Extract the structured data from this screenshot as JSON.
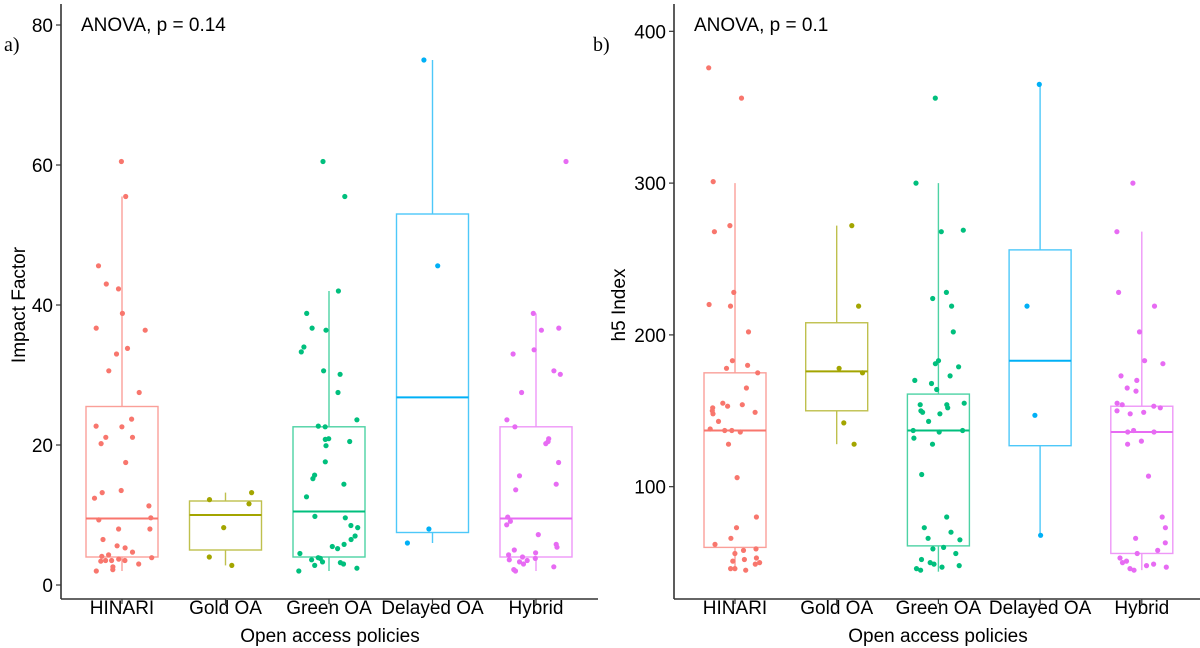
{
  "chart_data": [
    {
      "type": "boxplot",
      "panel_label": "a)",
      "annotation": "ANOVA, p = 0.14",
      "xlabel": "Open access policies",
      "ylabel": "Impact Factor",
      "ylim": [
        -2,
        83
      ],
      "yticks": [
        0,
        20,
        40,
        60,
        80
      ],
      "grid": false,
      "categories": [
        "HINARI",
        "Gold OA",
        "Green OA",
        "Delayed OA",
        "Hybrid"
      ],
      "colors": [
        "#F8766D",
        "#A3A500",
        "#00BF7D",
        "#00B0F6",
        "#E76BF3"
      ],
      "boxes": [
        {
          "name": "HINARI",
          "whisker_low": 2,
          "q1": 4,
          "median": 9.5,
          "q3": 25.5,
          "whisker_high": 55.5
        },
        {
          "name": "Gold OA",
          "whisker_low": 2.8,
          "q1": 5,
          "median": 10,
          "q3": 12,
          "whisker_high": 13.2
        },
        {
          "name": "Green OA",
          "whisker_low": 2,
          "q1": 4,
          "median": 10.5,
          "q3": 22.6,
          "whisker_high": 42
        },
        {
          "name": "Delayed OA",
          "whisker_low": 6,
          "q1": 7.5,
          "median": 26.8,
          "q3": 53,
          "whisker_high": 75
        },
        {
          "name": "Hybrid",
          "whisker_low": 2,
          "q1": 4,
          "median": 9.5,
          "q3": 22.6,
          "whisker_high": 38.8
        }
      ],
      "points": [
        {
          "name": "HINARI",
          "values": [
            60.5,
            55.5,
            45.6,
            43,
            42.3,
            38.8,
            36.7,
            36.4,
            33.8,
            33,
            30.6,
            27.5,
            23.7,
            22.7,
            22.6,
            21.1,
            21.1,
            20.2,
            17.5,
            13.5,
            13.2,
            12.4,
            11.3,
            9.6,
            9.3,
            8,
            8,
            6.5,
            5.6,
            5.3,
            4.7,
            4.3,
            4.1,
            3.9,
            3.7,
            3.5,
            3.5,
            3.5,
            3.4,
            3,
            2.6,
            2.2,
            2
          ]
        },
        {
          "name": "Gold OA",
          "values": [
            13.2,
            12.2,
            11.6,
            8.2,
            4,
            2.8
          ]
        },
        {
          "name": "Green OA",
          "values": [
            60.5,
            55.5,
            42,
            38.8,
            36.7,
            36.4,
            34,
            33.3,
            30.6,
            30.1,
            27.5,
            23.6,
            22.7,
            22.6,
            20.9,
            20.8,
            20.5,
            19.9,
            17.6,
            15.7,
            15.2,
            14.4,
            12.6,
            9.8,
            9.6,
            8.5,
            8.2,
            7,
            6.5,
            5.8,
            5.2,
            5.5,
            4.5,
            3.9,
            3.8,
            3.6,
            3.3,
            3.2,
            3,
            2.8,
            2.4,
            2
          ]
        },
        {
          "name": "Delayed OA",
          "values": [
            75,
            45.6,
            8,
            6
          ]
        },
        {
          "name": "Hybrid",
          "values": [
            60.5,
            38.8,
            36.7,
            36.4,
            33.6,
            33,
            30.6,
            30.1,
            27.5,
            23.6,
            22.6,
            20.9,
            20.5,
            20.2,
            17.5,
            15.6,
            14.4,
            13.6,
            9.7,
            9.1,
            8.6,
            7.2,
            5.8,
            5.4,
            5,
            4.6,
            4.3,
            4,
            3.8,
            3.6,
            3.5,
            3.3,
            3,
            2.6,
            2.2,
            2
          ]
        }
      ]
    },
    {
      "type": "boxplot",
      "panel_label": "b)",
      "annotation": "ANOVA, p = 0.1",
      "xlabel": "Open access policies",
      "ylabel": "h5 Index",
      "ylim": [
        26,
        418
      ],
      "yticks": [
        100,
        200,
        300,
        400
      ],
      "grid": false,
      "categories": [
        "HINARI",
        "Gold OA",
        "Green OA",
        "Delayed OA",
        "Hybrid"
      ],
      "colors": [
        "#F8766D",
        "#A3A500",
        "#00BF7D",
        "#00B0F6",
        "#E76BF3"
      ],
      "boxes": [
        {
          "name": "HINARI",
          "whisker_low": 45,
          "q1": 60,
          "median": 137,
          "q3": 175,
          "whisker_high": 300
        },
        {
          "name": "Gold OA",
          "whisker_low": 128,
          "q1": 150,
          "median": 176,
          "q3": 208,
          "whisker_high": 272
        },
        {
          "name": "Green OA",
          "whisker_low": 44,
          "q1": 61,
          "median": 137,
          "q3": 161,
          "whisker_high": 300
        },
        {
          "name": "Delayed OA",
          "whisker_low": 68,
          "q1": 127,
          "median": 183,
          "q3": 256,
          "whisker_high": 365
        },
        {
          "name": "Hybrid",
          "whisker_low": 45,
          "q1": 56,
          "median": 136,
          "q3": 153,
          "whisker_high": 268
        }
      ],
      "points": [
        {
          "name": "HINARI",
          "values": [
            376,
            356,
            301,
            272,
            268,
            228,
            219,
            220,
            202,
            183,
            180,
            178,
            175,
            165,
            154,
            155,
            153,
            152,
            149,
            148,
            150,
            143,
            137,
            138,
            136,
            137,
            128,
            106,
            80,
            73,
            66,
            62,
            59,
            58,
            56,
            53,
            52,
            51,
            50,
            49,
            46,
            46,
            45
          ]
        },
        {
          "name": "Gold OA",
          "values": [
            272,
            219,
            178,
            175,
            142,
            128
          ]
        },
        {
          "name": "Green OA",
          "values": [
            356,
            300,
            269,
            268,
            228,
            224,
            219,
            202,
            183,
            181,
            179,
            173,
            170,
            168,
            164,
            155,
            154,
            154,
            152,
            150,
            149,
            148,
            143,
            137,
            137,
            136,
            132,
            128,
            108,
            80,
            73,
            70,
            66,
            65,
            60,
            59,
            56,
            52,
            50,
            49,
            48,
            47,
            46,
            45
          ]
        },
        {
          "name": "Delayed OA",
          "values": [
            365,
            219,
            147,
            68
          ]
        },
        {
          "name": "Hybrid",
          "values": [
            300,
            268,
            228,
            219,
            202,
            183,
            181,
            173,
            170,
            165,
            163,
            155,
            154,
            153,
            152,
            150,
            149,
            148,
            137,
            136,
            136,
            130,
            128,
            107,
            80,
            73,
            66,
            63,
            58,
            56,
            53,
            51,
            50,
            49,
            48,
            47,
            46,
            45
          ]
        }
      ]
    }
  ]
}
